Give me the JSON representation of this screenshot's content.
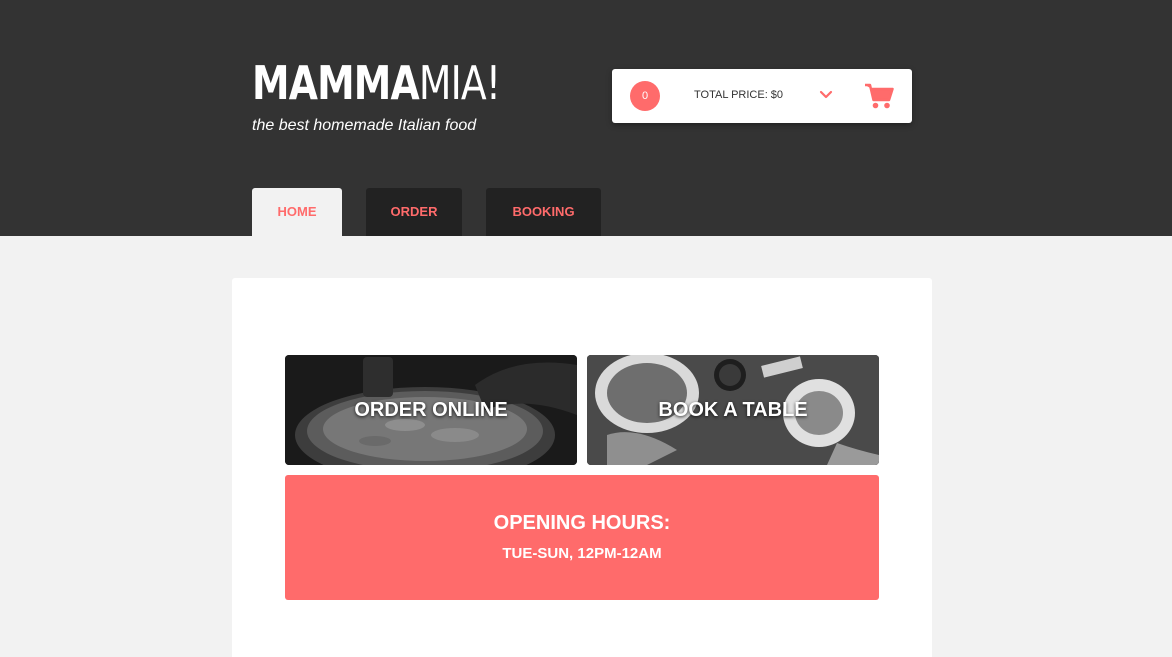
{
  "logo": {
    "bold": "MAMMA",
    "light": "MIA!"
  },
  "tagline": "the best homemade Italian food",
  "cart": {
    "count": "0",
    "total": "TOTAL PRICE: $0",
    "chevron_icon": "chevron-down-icon",
    "cart_icon": "shopping-cart-icon"
  },
  "nav": {
    "home": "HOME",
    "order": "ORDER",
    "booking": "BOOKING",
    "active": "HOME"
  },
  "tiles": {
    "order": "ORDER ONLINE",
    "book": "BOOK A TABLE"
  },
  "hours": {
    "title": "OPENING HOURS:",
    "time": "TUE-SUN, 12PM-12AM"
  },
  "colors": {
    "accent": "#ff6b6b",
    "header_bg": "#333333",
    "nav_bg": "#222222",
    "page_bg": "#f2f2f2"
  }
}
